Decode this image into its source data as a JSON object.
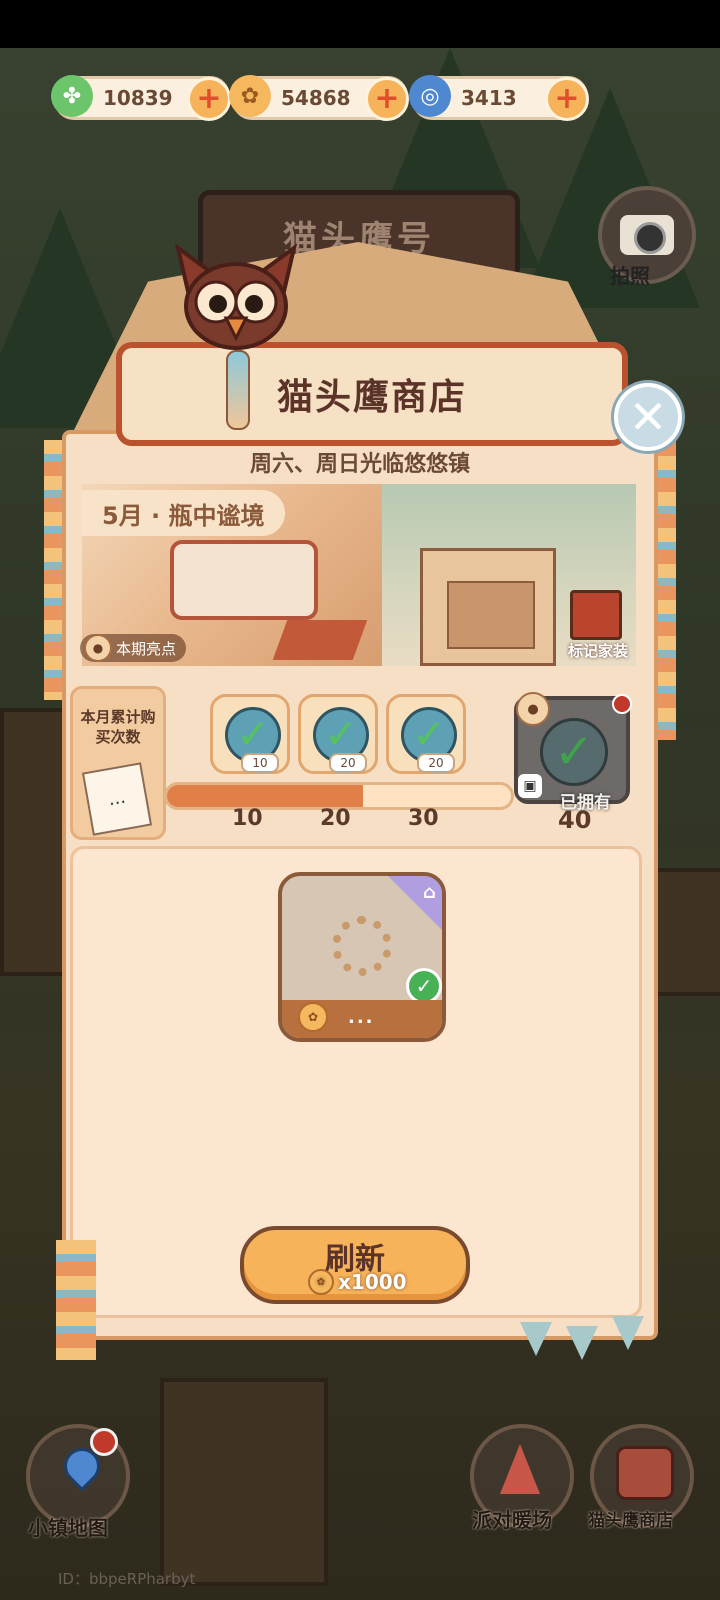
{
  "currencies": [
    {
      "icon": "clover-coin-icon",
      "value": "10839",
      "color": "#6cc56b"
    },
    {
      "icon": "gold-coin-icon",
      "value": "54868",
      "color": "#f5b85f"
    },
    {
      "icon": "blue-swirl-icon",
      "value": "3413",
      "color": "#4e88d1"
    }
  ],
  "background": {
    "sign": "猫头鹰号",
    "camera_label": "拍照"
  },
  "shop": {
    "title": "猫头鹰商店",
    "subtitle": "周六、周日光临悠悠镇",
    "month_tag": "5月 · 瓶中谧境",
    "highlight_label": "本期亮点",
    "mark_label": "标记家装"
  },
  "progress": {
    "counter_label": "本月累计购买次数",
    "counter_icon": "...",
    "fill_fraction": 0.57,
    "rewards": [
      {
        "badge": "10",
        "tick": "10"
      },
      {
        "badge": "20",
        "tick": "20"
      },
      {
        "badge": "20",
        "tick": "30"
      }
    ],
    "final": {
      "tick": "40",
      "owned_label": "已拥有"
    }
  },
  "item": {
    "price": "...",
    "corner_icon": "furniture-icon"
  },
  "refresh": {
    "label": "刷新",
    "cost": "x1000"
  },
  "bottom_nav": [
    {
      "label": "小镇地图",
      "icon": "map-pin-icon"
    },
    {
      "label": "派对暖场",
      "icon": "party-icon"
    },
    {
      "label": "猫头鹰商店",
      "icon": "owl-shop-icon"
    }
  ],
  "user_id": "ID：bbpeRPharbyt"
}
